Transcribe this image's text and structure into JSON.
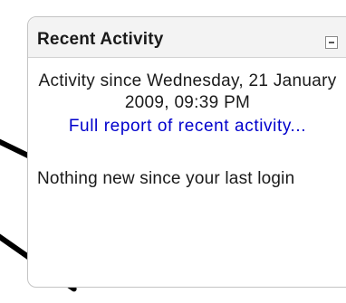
{
  "block": {
    "title": "Recent Activity",
    "toggle_icon": "collapse-minus-icon",
    "since_text": "Activity since Wednesday, 21 January 2009, 09:39 PM",
    "report_link": "Full report of recent activity...",
    "nothing_new": "Nothing new since your last login"
  },
  "colors": {
    "link": "#0000cc",
    "text": "#1a1a1a",
    "header_bg": "#f3f3f3",
    "border": "#c4c4c4",
    "annotation_stroke": "#000000"
  }
}
